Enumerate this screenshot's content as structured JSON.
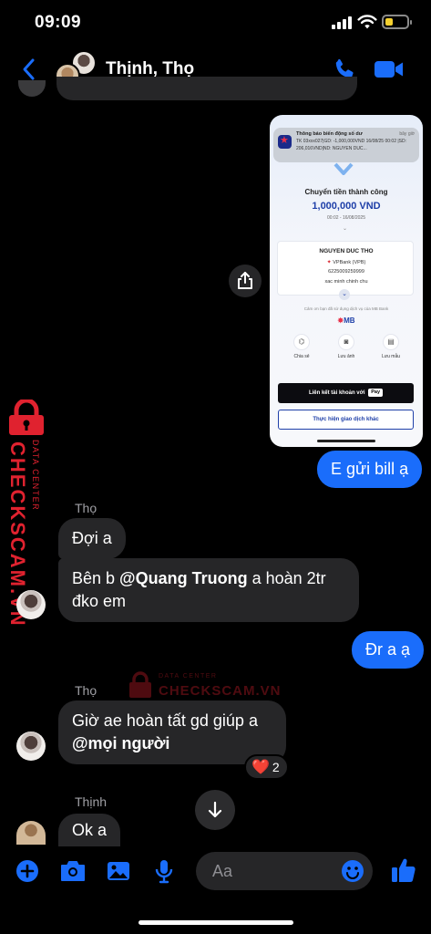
{
  "status_bar": {
    "time": "09:09",
    "battery_level": 0.35
  },
  "header": {
    "title": "Thịnh, Thọ"
  },
  "receipt": {
    "notification_title": "Thông báo biến động số dư",
    "notification_time": "bây giờ",
    "notification_body": "TK 03xxx027|GD: -1,000,000VND 16/08/25 00:02 |SD: 206,016VND|ND: NGUYEN DUC...",
    "success_title": "Chuyển tiền thành công",
    "amount": "1,000,000 VND",
    "datetime": "00:02 - 16/08/2025",
    "payee_name": "NGUYEN DUC THO",
    "payee_bank": "VPBank (VPB)",
    "payee_account": "6225009259999",
    "payee_note": "xac minh chinh chu",
    "thanks_text": "Cảm ơn bạn đã sử dụng dịch vụ của MB Bank",
    "brand": "MB",
    "actions": [
      {
        "label": "Chia sẻ",
        "icon": "share-icon"
      },
      {
        "label": "Lưu ảnh",
        "icon": "camera-icon"
      },
      {
        "label": "Lưu mẫu",
        "icon": "save-template-icon"
      }
    ],
    "link_button": "Liên kết tài khoản với",
    "apple_pay": "Pay",
    "other_button": "Thực hiện giao dịch khác"
  },
  "messages": [
    {
      "from": "me",
      "text": "E gửi bill ạ"
    },
    {
      "from": "Thọ",
      "sender_label": "Thọ",
      "text": "Đợi a"
    },
    {
      "from": "Thọ",
      "text_before": "Bên b ",
      "mention": "@Quang Truong",
      "text_after": "  a hoàn 2tr",
      "text_line2": "đko em"
    },
    {
      "from": "me",
      "text": "Đr a ạ"
    },
    {
      "from": "Thọ",
      "sender_label": "Thọ",
      "text": "Giờ ae hoàn tất gd giúp a",
      "mention": "@mọi người",
      "reaction": {
        "emoji": "❤️",
        "count": "2"
      }
    },
    {
      "from": "Thịnh",
      "sender_label": "Thịnh",
      "text": "Ok a"
    }
  ],
  "composer": {
    "placeholder": "Aa"
  },
  "watermark": {
    "brand": "CHECKSCAM.VN",
    "sub": "DATA CENTER"
  },
  "colors": {
    "accent": "#1a6dfb",
    "bubble_in": "#262628",
    "watermark": "#e0222f"
  }
}
